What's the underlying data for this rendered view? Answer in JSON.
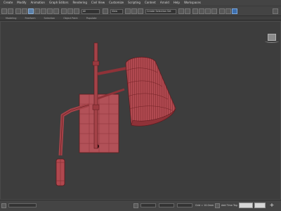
{
  "menubar": {
    "items": [
      "Create",
      "Modify",
      "Animation",
      "Graph Editors",
      "Rendering",
      "Civil View",
      "Customize",
      "Scripting",
      "Content",
      "Arnold",
      "Help",
      "Workspaces"
    ]
  },
  "toolbar": {
    "selection_filter": "All",
    "named_selection": "Create Selection Set",
    "view_label": "View"
  },
  "ribbon": {
    "tabs": [
      "Modeling",
      "Freeform",
      "Selection",
      "Object Paint",
      "Populate"
    ]
  },
  "viewport": {
    "object_color": "#a8454a",
    "wire_color": "#6f1f23",
    "background": "#3d3d3d",
    "viewcube_color": "#8a8a8a"
  },
  "statusbar": {
    "grid_readout": "Grid = 10.0mm",
    "tag_label": "Add Time Tag",
    "key_button_color": "#d7d7d7"
  }
}
